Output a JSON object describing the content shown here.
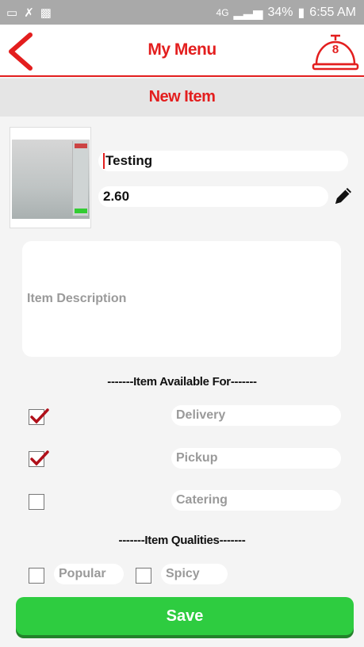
{
  "status_bar": {
    "left_icons": [
      "cast-icon",
      "missed-call-icon",
      "image-icon"
    ],
    "network": "4G",
    "battery": "34%",
    "time": "6:55 AM"
  },
  "header": {
    "title": "My Menu",
    "cart_count": "8",
    "accent_color": "#e31e1e"
  },
  "subheader": {
    "title": "New Item"
  },
  "form": {
    "name_value": "Testing",
    "price_value": "2.60",
    "description_placeholder": "Item Description"
  },
  "availability": {
    "heading": "-------Item Available For-------",
    "options": [
      {
        "label": "Delivery",
        "checked": true
      },
      {
        "label": "Pickup",
        "checked": true
      },
      {
        "label": "Catering",
        "checked": false
      }
    ]
  },
  "qualities": {
    "heading": "-------Item Qualities-------",
    "options": [
      {
        "label": "Popular",
        "checked": false
      },
      {
        "label": "Spicy",
        "checked": false
      }
    ]
  },
  "save_label": "Save",
  "save_color": "#2ecc40"
}
